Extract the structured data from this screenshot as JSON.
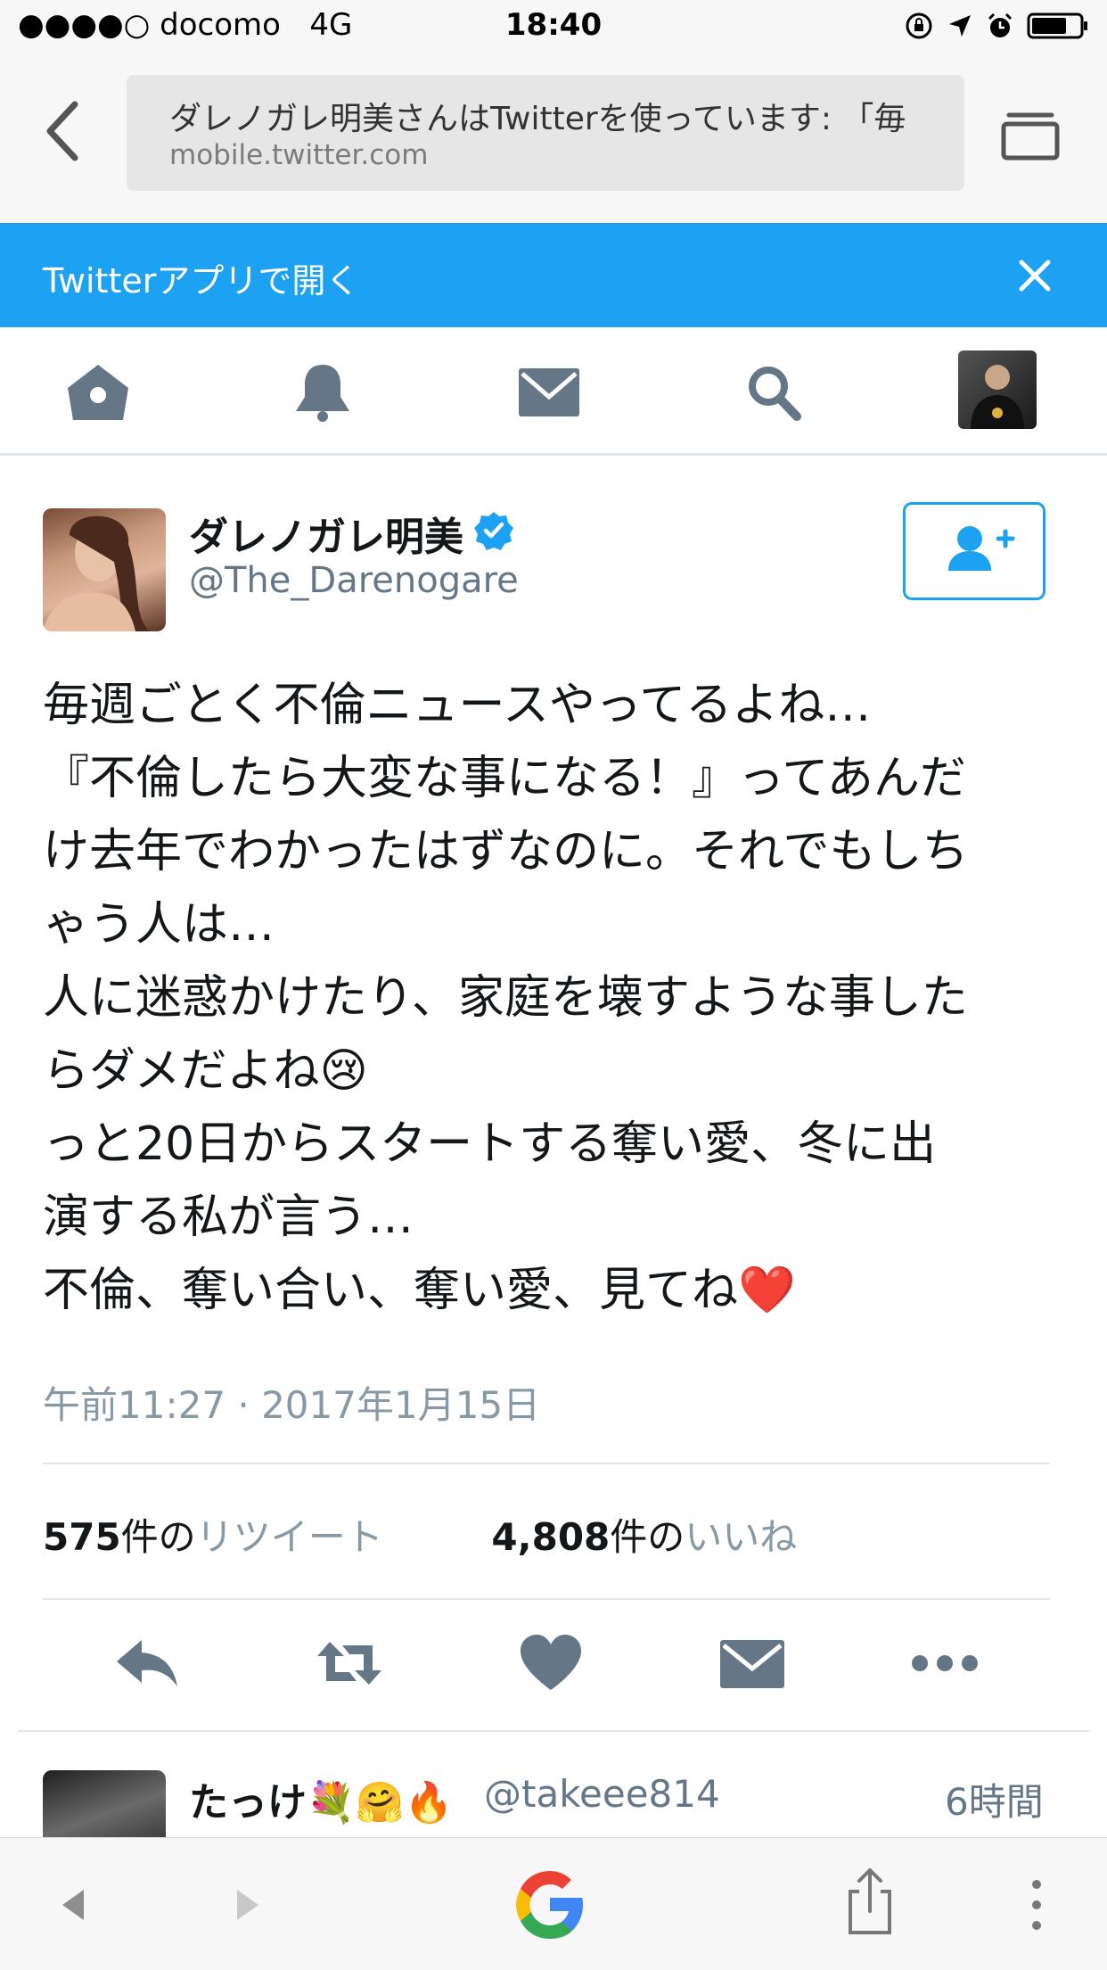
{
  "status_bar": {
    "carrier": "●●●●○ docomo   4G",
    "time": "18:40"
  },
  "browser": {
    "page_title": "ダレノガレ明美さんはTwitterを使っています: 「毎",
    "url": "mobile.twitter.com"
  },
  "banner": {
    "label": "Twitterアプリで開く"
  },
  "nav": {
    "items": [
      "home-icon",
      "notifications-icon",
      "messages-icon",
      "search-icon",
      "profile-avatar"
    ]
  },
  "tweet": {
    "author_name": "ダレノガレ明美",
    "author_handle": "@The_Darenogare",
    "text_lines": [
      "毎週ごとく不倫ニュースやってるよね…",
      "『不倫したら大変な事になる！』ってあんだ",
      "け去年でわかったはずなのに。それでもしち",
      "ゃう人は…",
      "人に迷惑かけたり、家庭を壊すような事した",
      "らダメだよね😢",
      "っと20日からスタートする奪い愛、冬に出",
      "演する私が言う…",
      "不倫、奪い合い、奪い愛、見てね❤️"
    ],
    "timestamp": "午前11:27 · 2017年1月15日",
    "retweets": {
      "count": "575",
      "unit": "件の",
      "label": "リツイート"
    },
    "likes": {
      "count": "4,808",
      "unit": "件の",
      "label": "いいね"
    }
  },
  "reply": {
    "name": "たっけ💐🤗🔥",
    "handle": "@takeee814",
    "time": "6時間"
  },
  "colors": {
    "twitter_blue": "#1da1f2",
    "icon_gray": "#657786",
    "verified": "#1da1f2"
  }
}
